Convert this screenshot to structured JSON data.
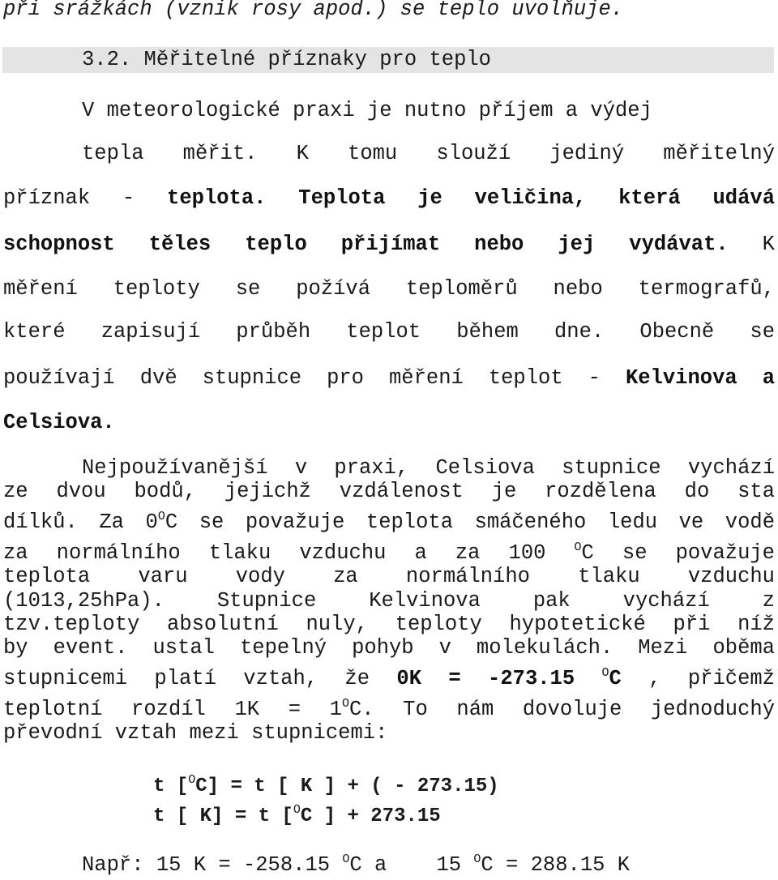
{
  "intro_line": "při srážkách (vznik rosy  apod.) se teplo uvolňuje.",
  "heading": "3.2. Měřitelné příznaky pro teplo",
  "para1": {
    "l1": "V meteorologické praxi je nutno příjem a výdej",
    "l2": "tepla měřit. K tomu slouží jediný měřitelný",
    "l3_plain": "příznak - ",
    "l3_bold": "teplota. Teplota je veličina, která udává",
    "l4_bold": "schopnost těles teplo přijímat nebo jej vydávat.",
    "l4_plain": " K",
    "l5": "měření teploty se požívá teploměrů nebo termografů,",
    "l6": "které zapisují průběh teplot během dne. Obecně se",
    "l7_plain": "používají dvě stupnice pro měření teplot - ",
    "l7_bold": "Kelvinova a",
    "l8_bold": "Celsiova."
  },
  "para2": {
    "l1": "Nejpoužívanější v praxi, Celsiova stupnice vychází",
    "l2": "ze dvou bodů, jejichž vzdálenost je rozdělena do sta",
    "l3a": "dílků. Za 0",
    "l3b": "C se považuje teplota smáčeného ledu ve vodě",
    "l4a": "za normálního tlaku vzduchu a za 100 ",
    "l4b": "C se považuje",
    "l5": "teplota varu vody za normálního tlaku vzduchu",
    "l6": "(1013,25hPa). Stupnice Kelvinova pak vychází z",
    "l7": "tzv.teploty absolutní nuly, teploty hypotetické při níž",
    "l8": "by event. ustal tepelný pohyb v molekulách. Mezi oběma",
    "l9a": "stupnicemi platí vztah, že ",
    "l9b": "0K = -273.15 ",
    "l9c": "C",
    "l9d": " , přičemž",
    "l10a": "teplotní rozdíl 1K = 1",
    "l10b": "C. To nám dovoluje jednoduchý",
    "l11": "převodní vztah mezi stupnicemi:"
  },
  "degree_mark": "O",
  "formulas": {
    "f1a": "t [",
    "f1b": "C] = t [ K ] + ( - 273.15)",
    "f2a": "t [ K] = t [",
    "f2b": "C ] + 273.15"
  },
  "example": {
    "a": "Např: 15 K = -258.15 ",
    "b": "C a    15 ",
    "c": "C = 288.15 K"
  }
}
